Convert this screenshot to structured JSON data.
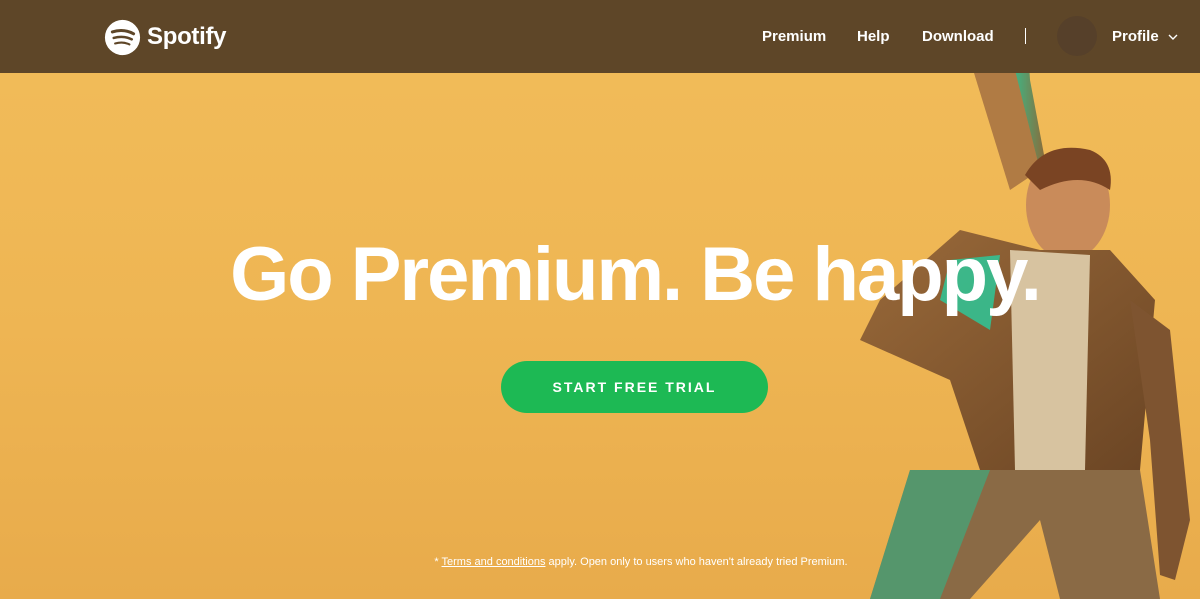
{
  "brand": {
    "name": "Spotify"
  },
  "nav": {
    "links": [
      {
        "label": "Premium"
      },
      {
        "label": "Help"
      },
      {
        "label": "Download"
      }
    ],
    "profile_label": "Profile"
  },
  "hero": {
    "headline": "Go Premium. Be happy.",
    "cta_label": "START FREE TRIAL",
    "footnote_prefix": "* ",
    "terms_link": "Terms and conditions",
    "footnote_suffix": " apply. Open only to users who haven't already tried Premium."
  },
  "colors": {
    "nav_bg": "#5e4628",
    "hero_bg": "#efb857",
    "cta_bg": "#1db954",
    "text": "#ffffff"
  },
  "icons": [
    "spotify-logo-icon",
    "chevron-down-icon",
    "avatar"
  ]
}
